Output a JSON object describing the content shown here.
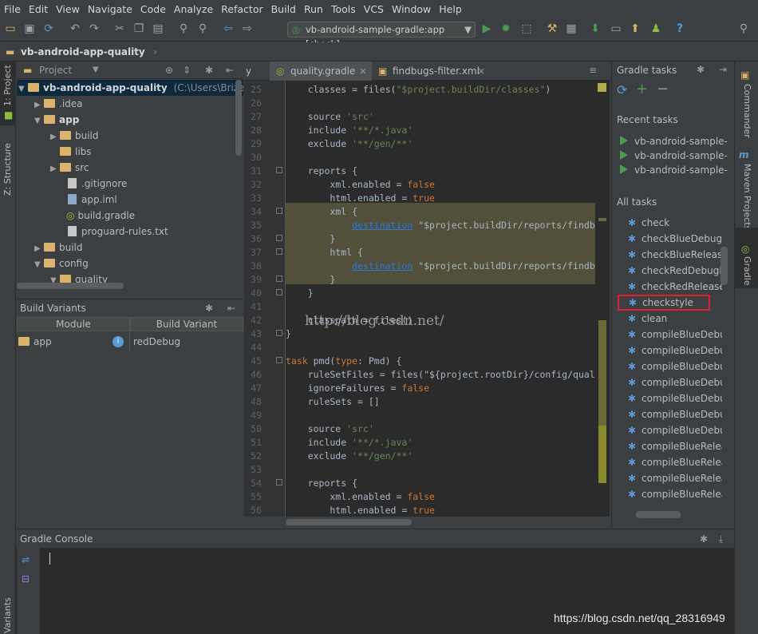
{
  "menu": [
    "File",
    "Edit",
    "View",
    "Navigate",
    "Code",
    "Analyze",
    "Refactor",
    "Build",
    "Run",
    "Tools",
    "VCS",
    "Window",
    "Help"
  ],
  "toolbar": {
    "run_config": "vb-android-sample-gradle:app [check]",
    "help_label": "?"
  },
  "breadcrumb": "vb-android-app-quality",
  "left_strip": {
    "project": "1: Project",
    "structure": "Z: Structure",
    "variants": "Variants"
  },
  "project_panel": {
    "title": "Project",
    "tree": [
      {
        "label": "vb-android-app-quality",
        "suffix": "(C:\\Users\\Brize\\Doc"
      },
      {
        "label": ".idea"
      },
      {
        "label": "app"
      },
      {
        "label": "build"
      },
      {
        "label": "libs"
      },
      {
        "label": "src"
      },
      {
        "label": ".gitignore"
      },
      {
        "label": "app.iml"
      },
      {
        "label": "build.gradle"
      },
      {
        "label": "proguard-rules.txt"
      },
      {
        "label": "build"
      },
      {
        "label": "config"
      },
      {
        "label": "quality"
      }
    ]
  },
  "build_variants": {
    "title": "Build Variants",
    "col_module": "Module",
    "col_variant": "Build Variant",
    "module": "app",
    "variant": "redDebug"
  },
  "editor": {
    "tab_prev": "y",
    "tab_active": "quality.gradle",
    "tab_other": "findbugs-filter.xml",
    "watermark": "http://blog.csdn.net/",
    "line_numbers": [
      "25",
      "26",
      "27",
      "28",
      "29",
      "30",
      "31",
      "32",
      "33",
      "34",
      "35",
      "36",
      "37",
      "38",
      "39",
      "40",
      "41",
      "42",
      "43",
      "44",
      "45",
      "46",
      "47",
      "48",
      "49",
      "50",
      "51",
      "52",
      "53",
      "54",
      "55",
      "56"
    ],
    "lines": [
      "    classes = files(\"$project.buildDir/classes\")",
      "",
      "    source 'src'",
      "    include '**/*.java'",
      "    exclude '**/gen/**'",
      "",
      "    reports {",
      "        xml.enabled = false",
      "        html.enabled = true",
      "        xml {",
      "            destination \"$project.buildDir/reports/findb",
      "        }",
      "        html {",
      "            destination \"$project.buildDir/reports/findb",
      "        }",
      "    }",
      "",
      "    classpath = files()",
      "}",
      "",
      "task pmd(type: Pmd) {",
      "    ruleSetFiles = files(\"${project.rootDir}/config/qual",
      "    ignoreFailures = false",
      "    ruleSets = []",
      "",
      "    source 'src'",
      "    include '**/*.java'",
      "    exclude '**/gen/**'",
      "",
      "    reports {",
      "        xml.enabled = false",
      "        html.enabled = true"
    ]
  },
  "gradle": {
    "title": "Gradle tasks",
    "recent_label": "Recent tasks",
    "recent": [
      "vb-android-sample-...",
      "vb-android-sample-...",
      "vb-android-sample-..."
    ],
    "all_label": "All tasks",
    "tasks": [
      "check",
      "checkBlueDebugM",
      "checkBlueRelease",
      "checkRedDebugM",
      "checkRedReleaseM",
      "checkstyle",
      "clean",
      "compileBlueDebu",
      "compileBlueDebu",
      "compileBlueDebu",
      "compileBlueDebu",
      "compileBlueDebu",
      "compileBlueDebu",
      "compileBlueDebu",
      "compileBlueRelea",
      "compileBlueRelea",
      "compileBlueRelea",
      "compileBlueRelea"
    ],
    "highlight_color": "#e0202a"
  },
  "right_strip": {
    "commander": "Commander",
    "maven": "Maven Projects",
    "gradle": "Gradle"
  },
  "console": {
    "title": "Gradle Console"
  },
  "watermark": "https://blog.csdn.net/qq_28316949"
}
